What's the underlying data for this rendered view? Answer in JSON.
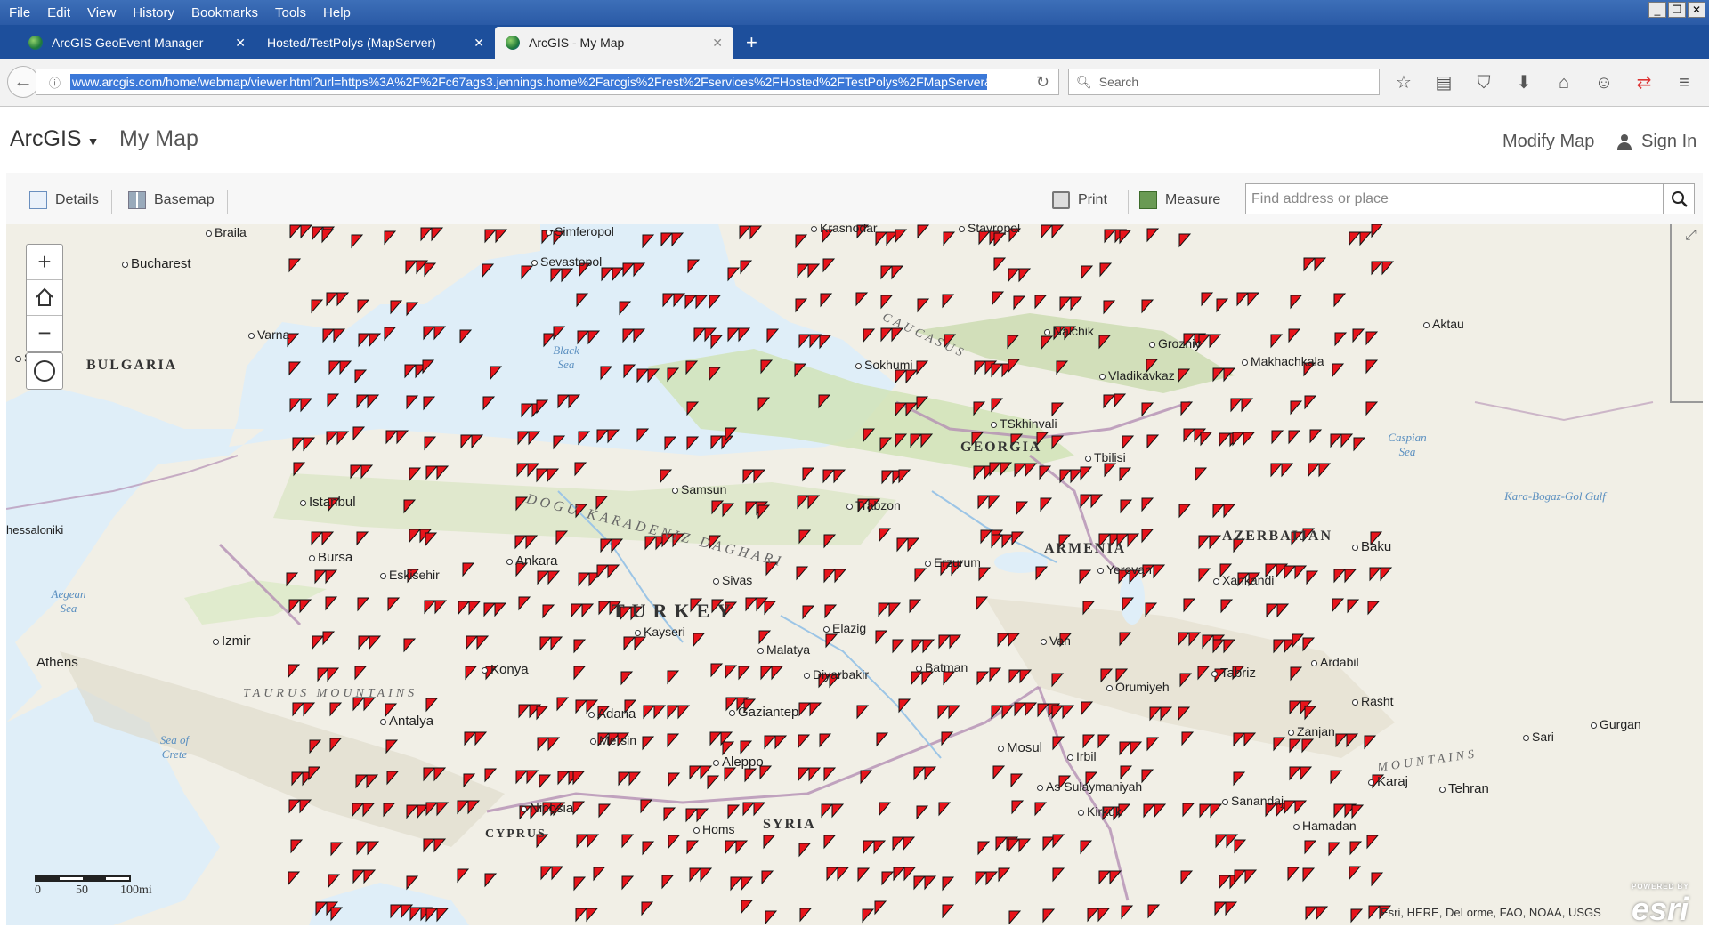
{
  "menu": {
    "items": [
      "File",
      "Edit",
      "View",
      "History",
      "Bookmarks",
      "Tools",
      "Help"
    ]
  },
  "tabs": [
    {
      "label": "ArcGIS GeoEvent Manager",
      "active": false
    },
    {
      "label": "Hosted/TestPolys (MapServer)",
      "active": false
    },
    {
      "label": "ArcGIS - My Map",
      "active": true
    }
  ],
  "navbar": {
    "url": "www.arcgis.com/home/webmap/viewer.html?url=https%3A%2F%2Fc67ags3.jennings.home%2Farcgis%2Frest%2Fservices%2FHosted%2FTestPolys%2FMapServer&s",
    "search_placeholder": "Search",
    "icons": [
      "star-icon",
      "reader-icon",
      "pocket-icon",
      "download-icon",
      "home-icon",
      "emoji-icon",
      "sync-icon",
      "menu-icon"
    ]
  },
  "header": {
    "brand": "ArcGIS",
    "title": "My Map",
    "modify": "Modify Map",
    "signin": "Sign In"
  },
  "toolbar": {
    "details": "Details",
    "basemap": "Basemap",
    "print": "Print",
    "measure": "Measure",
    "find_placeholder": "Find address or place"
  },
  "map": {
    "scale": {
      "zero": "0",
      "mid": "50",
      "end": "100mi"
    },
    "attribution": "Esri, HERE, DeLorme, FAO, NOAA, USGS",
    "esri_logo": "esri",
    "esri_powered": "POWERED BY",
    "marker_color": "#e8141b",
    "labels": {
      "braila": "Braila",
      "bucharest": "Bucharest",
      "varna": "Varna",
      "bulgaria": "BULGARIA",
      "sofia": "Sofia",
      "simferopol": "Simferopol",
      "sevastopol": "Sevastopol",
      "krasnodar": "Krasnodar",
      "stavropol": "Stavropol",
      "nalchik": "Nalchik",
      "grozniy": "Grozniy",
      "vladikavkaz": "Vladikavkaz",
      "makhachkala": "Makhachkala",
      "aktau": "Aktau",
      "black_sea": "Black Sea",
      "sokhumi": "Sokhumi",
      "tskhinvali": "TSkhinvali",
      "georgia": "GEORGIA",
      "tbilisi": "Tbilisi",
      "caspian": "Caspian Sea",
      "kara_bogaz": "Kara-Bogaz-Gol Gulf",
      "istanbul": "Istanbul",
      "samsun": "Samsun",
      "trabzon": "Trabzon",
      "thessaloniki": "hessaloniki",
      "bursa": "Bursa",
      "ankara": "Ankara",
      "eskisehir": "Eskisehir",
      "erzurum": "Erzurum",
      "armenia": "ARMENIA",
      "yerevan": "Yerevan",
      "azerbaijan": "AZERBAIJAN",
      "baku": "Baku",
      "xankandi": "Xankandi",
      "aegean": "Aegean Sea",
      "turkey": "TURKEY",
      "sivas": "Sivas",
      "kayseri": "Kayseri",
      "izmir": "Izmir",
      "elazig": "Elazig",
      "malatya": "Malatya",
      "athens": "Athens",
      "konya": "Konya",
      "diyarbakir": "Diyarbakir",
      "batman": "Batman",
      "van": "Van",
      "tabriz": "Tabriz",
      "ardabil": "Ardabil",
      "urmiyeh": "Orumiyeh",
      "taurus": "TAURUS MOUNTAINS",
      "antalya": "Antalya",
      "adana": "Adana",
      "gaziantep": "Gaziantep",
      "mersin": "Mersin",
      "rasht": "Rasht",
      "gorgan": "Gurgan",
      "sari": "Sari",
      "zanjan": "Zanjan",
      "mosul": "Mosul",
      "irbil": "Irbil",
      "aleppo": "Aleppo",
      "sea_of_crete": "Sea of Crete",
      "as_sulaymaniyah": "As Sulaymaniyah",
      "karaj": "Karaj",
      "tehran": "Tehran",
      "kirkuk": "Kirkuk",
      "sanandaj": "Sanandaj",
      "nicosia": "Nicosia",
      "cyprus": "CYPRUS",
      "homs": "Homs",
      "syria": "SYRIA",
      "hamadan": "Hamadan",
      "caucasus": "CAUCASUS",
      "pontic": "DOGU KARADENIZ DAGHARI",
      "zagros": "ZAGROS MOUNTAINS",
      "caspian_mtn": "MOUNTAINS"
    }
  }
}
